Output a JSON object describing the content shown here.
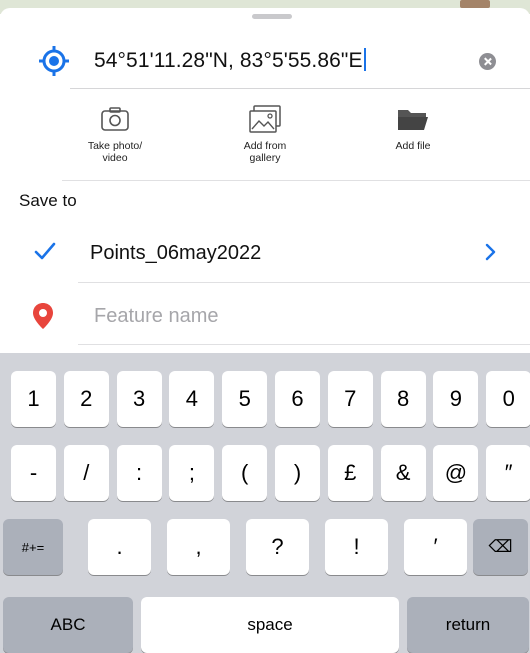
{
  "location": {
    "coordinates": "54°51'11.28\"N, 83°5'55.86\"E",
    "icon": "location-target-icon",
    "clear_icon": "clear-icon"
  },
  "attachments": [
    {
      "label": "Take photo/\nvideo",
      "icon": "camera-icon"
    },
    {
      "label": "Add from\ngallery",
      "icon": "gallery-icon"
    },
    {
      "label": "Add file",
      "icon": "folder-icon"
    }
  ],
  "save_to": {
    "heading": "Save to",
    "selected": "Points_06may2022",
    "check_icon": "checkmark-icon",
    "chevron_icon": "chevron-right-icon"
  },
  "feature": {
    "placeholder": "Feature name",
    "value": "",
    "icon": "map-pin-icon"
  },
  "keyboard": {
    "row1": [
      "1",
      "2",
      "3",
      "4",
      "5",
      "6",
      "7",
      "8",
      "9",
      "0"
    ],
    "row2": [
      "-",
      "/",
      ":",
      ";",
      "(",
      ")",
      "£",
      "&",
      "@",
      "″"
    ],
    "row3": [
      "#+=",
      ".",
      ",",
      "?",
      "!",
      "′",
      "⌫"
    ],
    "row4": [
      "ABC",
      "space",
      "return"
    ]
  },
  "colors": {
    "accent": "#1a73e8",
    "pin": "#e8453c",
    "keyboard_bg": "#d1d3d9"
  }
}
